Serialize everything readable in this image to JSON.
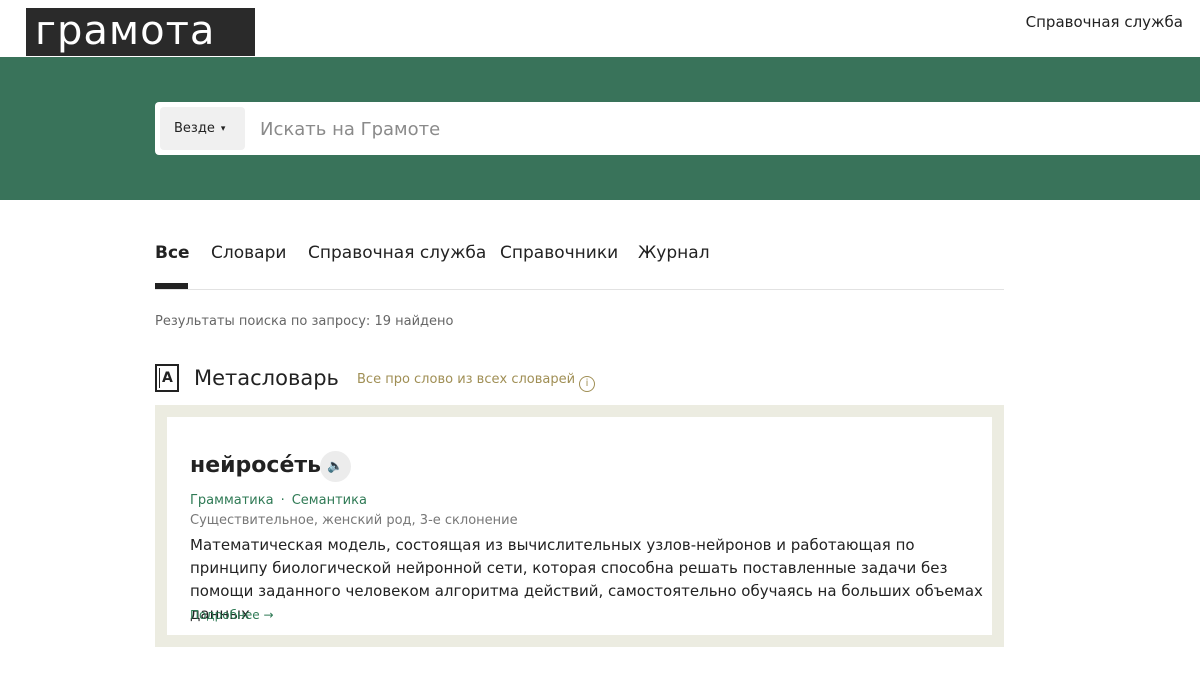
{
  "header": {
    "logo_text": "грамота",
    "help_link": "Справочная служба"
  },
  "search": {
    "scope_label": "Везде",
    "placeholder": "Искать на Грамоте",
    "value": ""
  },
  "tabs": [
    {
      "label": "Все",
      "active": true
    },
    {
      "label": "Словари",
      "active": false
    },
    {
      "label": "Справочная служба",
      "active": false
    },
    {
      "label": "Справочники",
      "active": false
    },
    {
      "label": "Журнал",
      "active": false
    }
  ],
  "results": {
    "count_text": "Результаты поиска по запросу: 19 найдено"
  },
  "metadictionary": {
    "icon_letter": "A",
    "title": "Метасловарь",
    "subtitle": "Все про слово из всех словарей",
    "info_icon": "i"
  },
  "entry": {
    "word": "нейросе́ть",
    "audio_icon": "🔈",
    "links": [
      "Грамматика",
      "Семантика"
    ],
    "link_separator": "·",
    "grammar": "Существительное, женский род, 3-е склонение",
    "definition": "Математическая модель, состоящая из вычислительных узлов-нейронов и работающая по принципу биологической нейронной сети, которая способна решать поставленные задачи без помощи заданного человеком алгоритма действий, самостоятельно обучаясь на больших объемах данных",
    "more_link": "Подробнее →"
  },
  "colors": {
    "hero_bg": "#39735a",
    "accent_green": "#2f7a55",
    "subtitle_gold": "#a08f55",
    "card_border_bg": "#ecece1"
  }
}
